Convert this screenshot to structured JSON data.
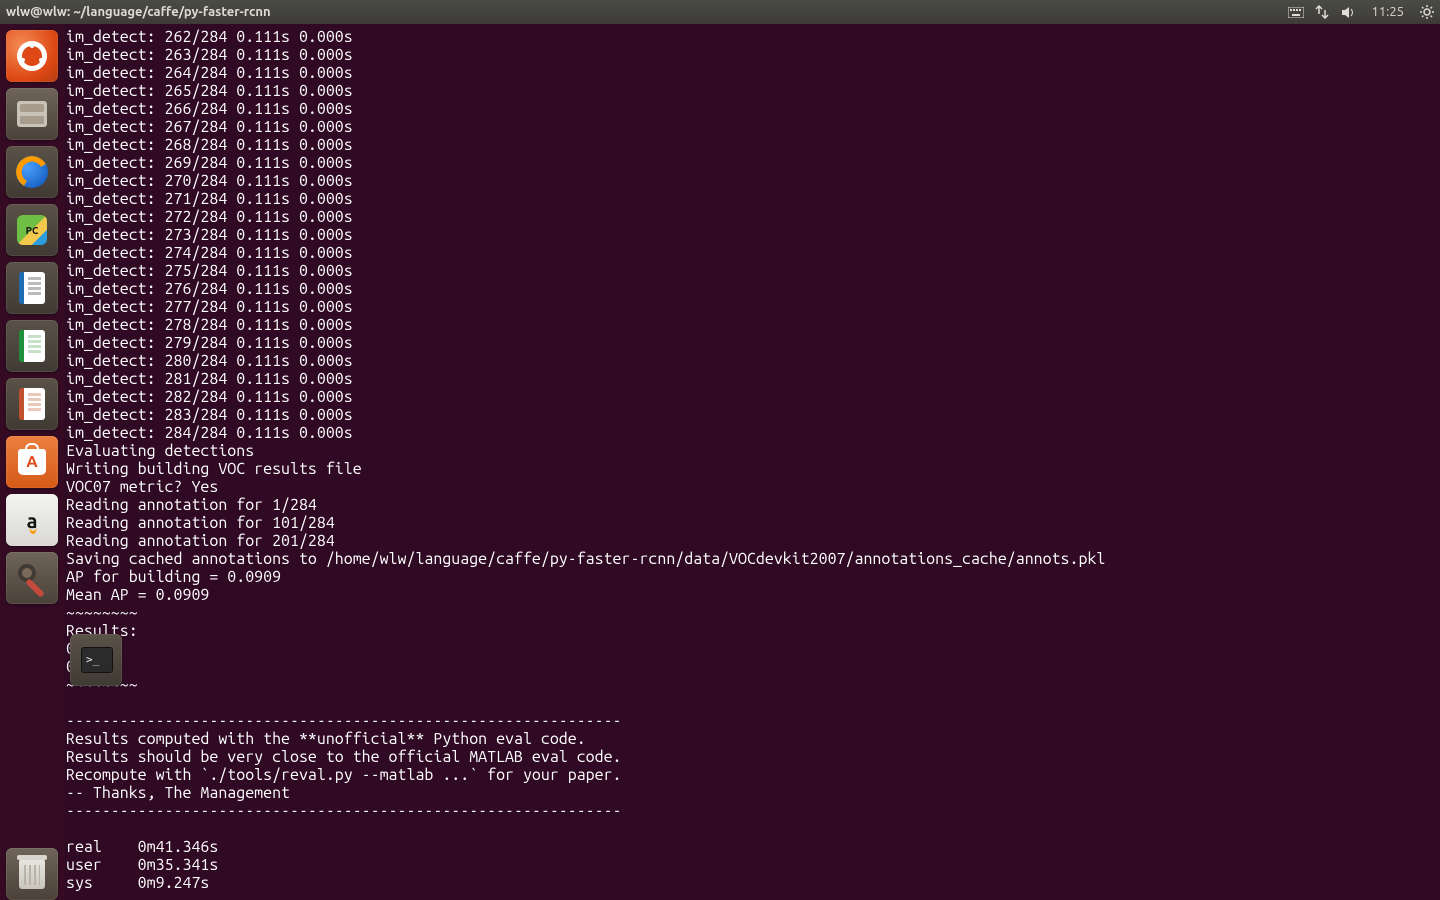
{
  "panel": {
    "title": "wlw@wlw: ~/language/caffe/py-faster-rcnn",
    "clock": "11:25"
  },
  "launcher": {
    "dash": "Dash",
    "files": "Files",
    "firefox": "Firefox",
    "pycharm": "PyCharm",
    "writer": "LibreOffice Writer",
    "calc": "LibreOffice Calc",
    "impress": "LibreOffice Impress",
    "software": "Ubuntu Software",
    "amazon": "Amazon",
    "settings": "System Settings",
    "terminal": "Terminal",
    "trash": "Trash"
  },
  "pc_label": "PC",
  "amz_label": "a",
  "term_prompt": ">_",
  "terminal": {
    "lines": [
      "im_detect: 262/284 0.111s 0.000s",
      "im_detect: 263/284 0.111s 0.000s",
      "im_detect: 264/284 0.111s 0.000s",
      "im_detect: 265/284 0.111s 0.000s",
      "im_detect: 266/284 0.111s 0.000s",
      "im_detect: 267/284 0.111s 0.000s",
      "im_detect: 268/284 0.111s 0.000s",
      "im_detect: 269/284 0.111s 0.000s",
      "im_detect: 270/284 0.111s 0.000s",
      "im_detect: 271/284 0.111s 0.000s",
      "im_detect: 272/284 0.111s 0.000s",
      "im_detect: 273/284 0.111s 0.000s",
      "im_detect: 274/284 0.111s 0.000s",
      "im_detect: 275/284 0.111s 0.000s",
      "im_detect: 276/284 0.111s 0.000s",
      "im_detect: 277/284 0.111s 0.000s",
      "im_detect: 278/284 0.111s 0.000s",
      "im_detect: 279/284 0.111s 0.000s",
      "im_detect: 280/284 0.111s 0.000s",
      "im_detect: 281/284 0.111s 0.000s",
      "im_detect: 282/284 0.111s 0.000s",
      "im_detect: 283/284 0.111s 0.000s",
      "im_detect: 284/284 0.111s 0.000s",
      "Evaluating detections",
      "Writing building VOC results file",
      "VOC07 metric? Yes",
      "Reading annotation for 1/284",
      "Reading annotation for 101/284",
      "Reading annotation for 201/284",
      "Saving cached annotations to /home/wlw/language/caffe/py-faster-rcnn/data/VOCdevkit2007/annotations_cache/annots.pkl",
      "AP for building = 0.0909",
      "Mean AP = 0.0909",
      "~~~~~~~~",
      "Results:",
      "0.091",
      "0.091",
      "~~~~~~~~",
      "",
      "--------------------------------------------------------------",
      "Results computed with the **unofficial** Python eval code.",
      "Results should be very close to the official MATLAB eval code.",
      "Recompute with `./tools/reval.py --matlab ...` for your paper.",
      "-- Thanks, The Management",
      "--------------------------------------------------------------",
      "",
      "real    0m41.346s",
      "user    0m35.341s",
      "sys     0m9.247s"
    ]
  }
}
